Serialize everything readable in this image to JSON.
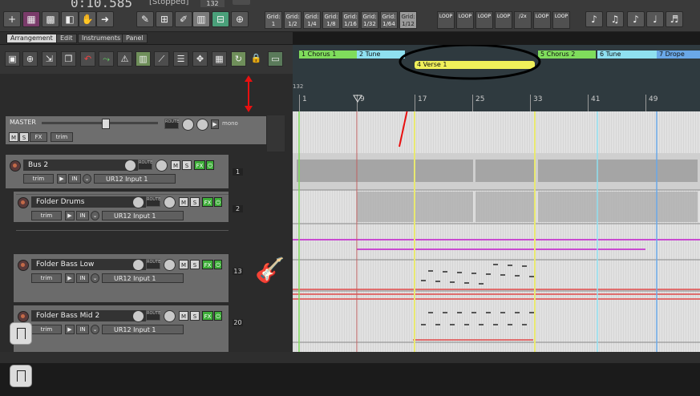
{
  "transport": {
    "time": "0:10.585",
    "status": "[Stopped]",
    "bpm": "132"
  },
  "grid": {
    "buttons": [
      {
        "label": "Grid:",
        "value": "1"
      },
      {
        "label": "Grid:",
        "value": "1/2"
      },
      {
        "label": "Grid:",
        "value": "1/4"
      },
      {
        "label": "Grid:",
        "value": "1/8"
      },
      {
        "label": "Grid:",
        "value": "1/16"
      },
      {
        "label": "Grid:",
        "value": "1/32"
      },
      {
        "label": "Grid:",
        "value": "1/64"
      },
      {
        "label": "Grid:",
        "value": "1/12"
      }
    ],
    "active_index": 7
  },
  "loop_buttons": [
    "LOOP",
    "LOOP",
    "LOOP",
    "LOOP",
    "/2x",
    "LOOP",
    "LOOP"
  ],
  "tabs": [
    "Arrangement",
    "Edit",
    "Instruments",
    "Panel"
  ],
  "active_tab": "Arrangement",
  "tcp": {
    "master": {
      "name": "MASTER",
      "mute": "M",
      "solo": "S",
      "fx": "FX",
      "trim": "trim",
      "mono": "mono",
      "route": "ROUTE"
    },
    "tracks": [
      {
        "name": "Bus 2",
        "number": "1",
        "input": "UR12 Input 1"
      },
      {
        "name": "Folder Drums",
        "number": "2",
        "input": "UR12 Input 1"
      },
      {
        "name": "Folder Bass Low",
        "number": "13",
        "input": "UR12 Input 1"
      },
      {
        "name": "Folder Bass Mid 2",
        "number": "20",
        "input": "UR12 Input 1"
      }
    ],
    "labels": {
      "trim": "trim",
      "in": "IN",
      "mute": "M",
      "solo": "S",
      "fx": "FX",
      "route": "ROUTE"
    }
  },
  "ruler": {
    "bpm_marker": "132",
    "bars": [
      "1",
      "9",
      "17",
      "25",
      "33",
      "41",
      "49"
    ]
  },
  "regions": [
    {
      "label": "1  Chorus 1",
      "color": "#7fdc5c"
    },
    {
      "label": "2  Tune",
      "color": "#8fe0f0"
    },
    {
      "label": "4  Verse 1",
      "color": "#f0f05a"
    },
    {
      "label": "5  Chorus 2",
      "color": "#7fdc5c"
    },
    {
      "label": "6  Tune",
      "color": "#8fe0f0"
    },
    {
      "label": "7  Drope",
      "color": "#6aa8e8"
    }
  ],
  "colors": {
    "highlight": "#e81010",
    "accent_green": "#3fae3a"
  }
}
